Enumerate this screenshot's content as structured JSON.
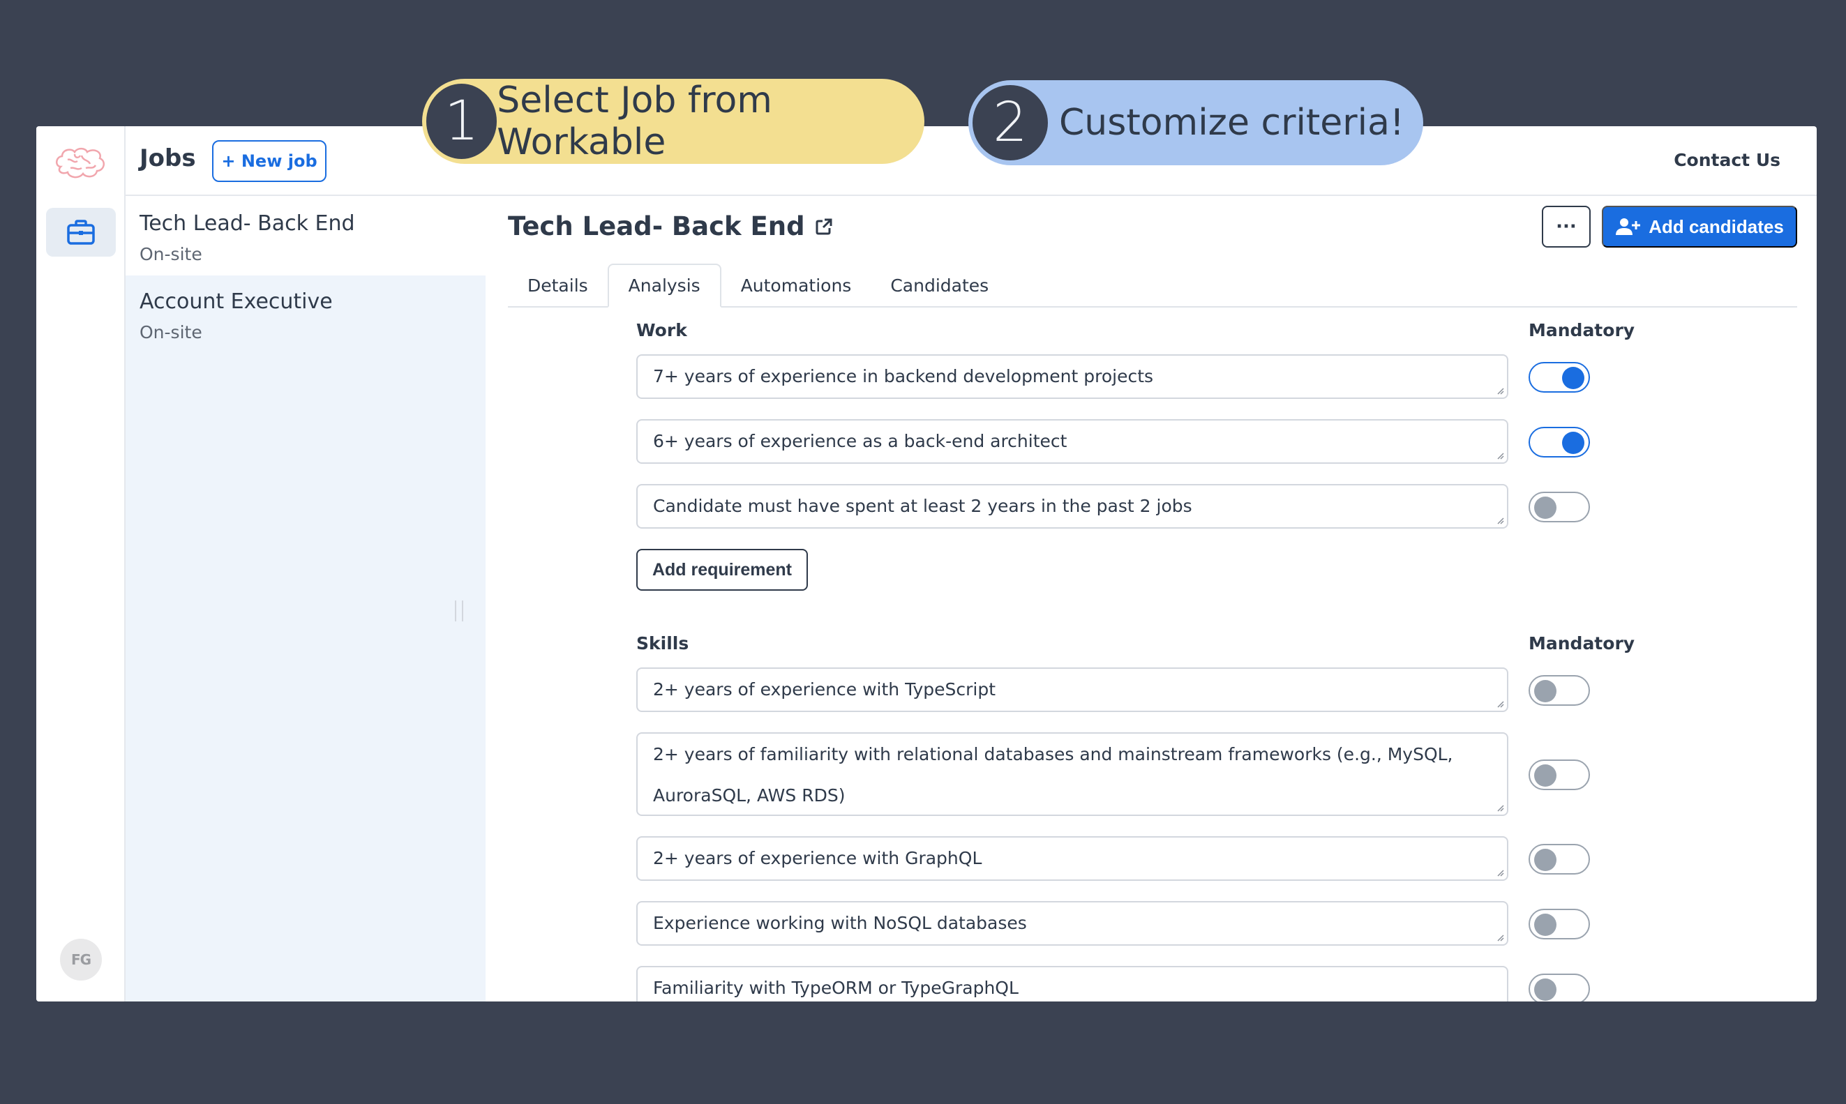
{
  "steps": [
    {
      "number": "1",
      "text": "Select Job from Workable"
    },
    {
      "number": "2",
      "text": "Customize criteria!"
    }
  ],
  "header": {
    "title": "Jobs",
    "new_job_label": "+ New job",
    "contact_label": "Contact Us"
  },
  "sidebar": {
    "avatar_initials": "FG"
  },
  "jobs": [
    {
      "name": "Tech Lead- Back End",
      "location": "On-site"
    },
    {
      "name": "Account Executive",
      "location": "On-site"
    }
  ],
  "detail": {
    "title": "Tech Lead- Back End",
    "more_label": "···",
    "add_candidates_label": "Add candidates",
    "tabs": [
      "Details",
      "Analysis",
      "Automations",
      "Candidates"
    ],
    "active_tab": "Analysis"
  },
  "work": {
    "label": "Work",
    "mandatory_label": "Mandatory",
    "requirements": [
      {
        "text": "7+ years of experience in backend development projects",
        "mandatory": true
      },
      {
        "text": "6+ years of experience as a back-end architect",
        "mandatory": true
      },
      {
        "text": "Candidate must have spent at least 2 years in the past 2 jobs",
        "mandatory": false
      }
    ],
    "add_label": "Add requirement"
  },
  "skills": {
    "label": "Skills",
    "mandatory_label": "Mandatory",
    "requirements": [
      {
        "text": "2+ years of experience with TypeScript",
        "mandatory": false
      },
      {
        "text": "2+ years of familiarity with relational databases and mainstream frameworks (e.g., MySQL, AuroraSQL, AWS RDS)",
        "mandatory": false
      },
      {
        "text": "2+ years of experience with GraphQL",
        "mandatory": false
      },
      {
        "text": "Experience working with NoSQL databases",
        "mandatory": false
      },
      {
        "text": "Familiarity with TypeORM or TypeGraphQL",
        "mandatory": false
      }
    ]
  },
  "colors": {
    "primary": "#1a6de0",
    "background": "#3b4252",
    "step1": "#f3df91",
    "step2": "#a8c5f0"
  }
}
